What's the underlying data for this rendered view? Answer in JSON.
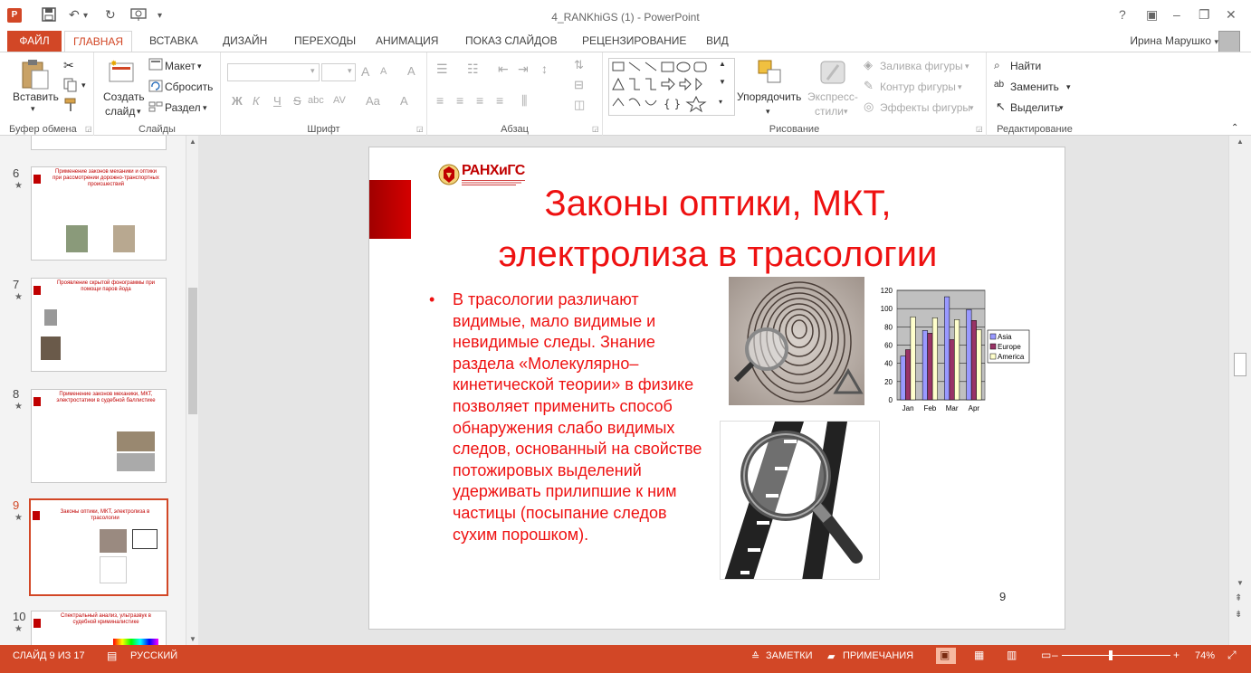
{
  "window": {
    "title": "4_RANKhiGS (1) - PowerPoint",
    "user": "Ирина Марушко"
  },
  "qat": {
    "save": "save-icon",
    "undo": "undo-icon",
    "redo": "redo-icon",
    "present": "present-icon"
  },
  "tabs": [
    {
      "label": "ФАЙЛ"
    },
    {
      "label": "ГЛАВНАЯ"
    },
    {
      "label": "ВСТАВКА"
    },
    {
      "label": "ДИЗАЙН"
    },
    {
      "label": "ПЕРЕХОДЫ"
    },
    {
      "label": "АНИМАЦИЯ"
    },
    {
      "label": "ПОКАЗ СЛАЙДОВ"
    },
    {
      "label": "РЕЦЕНЗИРОВАНИЕ"
    },
    {
      "label": "ВИД"
    }
  ],
  "ribbon": {
    "clipboard": {
      "label": "Буфер обмена",
      "paste": "Вставить"
    },
    "slides": {
      "label": "Слайды",
      "new_slide_1": "Создать",
      "new_slide_2": "слайд",
      "layout": "Макет",
      "reset": "Сбросить",
      "section": "Раздел"
    },
    "font": {
      "label": "Шрифт",
      "bold": "Ж",
      "italic": "К",
      "underline": "Ч",
      "strike": "S",
      "shadow": "abc",
      "spacing": "AV",
      "case": "Aa",
      "grow": "A",
      "shrink": "A",
      "clear": "A"
    },
    "paragraph": {
      "label": "Абзац"
    },
    "drawing": {
      "label": "Рисование",
      "arrange": "Упорядочить",
      "styles_1": "Экспресс-",
      "styles_2": "стили",
      "fill": "Заливка фигуры",
      "outline": "Контур фигуры",
      "effects": "Эффекты фигуры"
    },
    "editing": {
      "label": "Редактирование",
      "find": "Найти",
      "replace": "Заменить",
      "select": "Выделить"
    }
  },
  "thumbnails": [
    {
      "num": "6",
      "title": "Применение законов механики и оптики при рассмотрении дорожно-транспортных происшествий"
    },
    {
      "num": "7",
      "title": "Проявление скрытой фонограммы при помощи паров йода"
    },
    {
      "num": "8",
      "title": "Применение законов механики, МКТ, электростатики в судебной баллистике"
    },
    {
      "num": "9",
      "title": "Законы оптики, МКТ, электролиза в трасологии"
    },
    {
      "num": "10",
      "title": "Спектральный анализ, ультразвук в судебной криминалистике"
    }
  ],
  "slide": {
    "logo": "РАНХиГС",
    "title": "Законы оптики, МКТ, электролиза в трасологии",
    "bullet": "•",
    "body": "В трасологии различают видимые, мало видимые и невидимые следы. Знание раздела «Молекулярно–кинетической теории» в физике позволяет применить способ обнаружения слабо видимых следов, основанный на свойстве потожировых выделений удерживать прилипшие к ним частицы (посыпание следов сухим порошком).",
    "number": "9"
  },
  "chart_data": {
    "type": "bar",
    "categories": [
      "Jan",
      "Feb",
      "Mar",
      "Apr"
    ],
    "series": [
      {
        "name": "Asia",
        "values": [
          48,
          76,
          113,
          99
        ],
        "color": "#9999ff"
      },
      {
        "name": "Europe",
        "values": [
          55,
          73,
          66,
          87
        ],
        "color": "#993366"
      },
      {
        "name": "America",
        "values": [
          91,
          90,
          88,
          77
        ],
        "color": "#ffffcc"
      }
    ],
    "yticks": [
      "0",
      "20",
      "40",
      "60",
      "80",
      "100",
      "120"
    ],
    "ylim": [
      0,
      120
    ],
    "legend": "right"
  },
  "status": {
    "slide": "СЛАЙД 9 ИЗ 17",
    "lang": "РУССКИЙ",
    "notes": "ЗАМЕТКИ",
    "comments": "ПРИМЕЧАНИЯ",
    "zoom": "74%"
  }
}
